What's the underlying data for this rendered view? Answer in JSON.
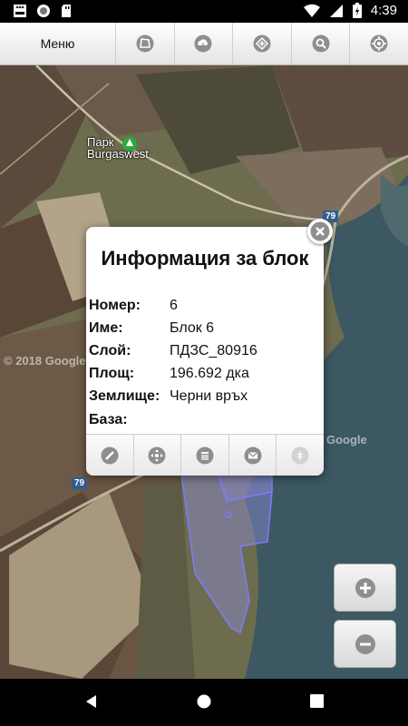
{
  "status_bar": {
    "time": "4:39",
    "icons": [
      "notification-app-icon",
      "circle-app-icon",
      "sd-card-icon",
      "wifi-icon",
      "signal-icon",
      "battery-icon"
    ]
  },
  "toolbar": {
    "menu_label": "Меню",
    "buttons": [
      "polygon-icon",
      "cloud-download-icon",
      "layers-icon",
      "search-icon",
      "gps-target-icon"
    ]
  },
  "map": {
    "poi_label_line1": "Парк",
    "poi_label_line2": "Burgaswest",
    "road_shield_top": "79",
    "road_shield_bottom": "79",
    "watermark_left": "© 2018 Google",
    "watermark_right": "Google"
  },
  "popup": {
    "title": "Информация за блок",
    "rows": [
      {
        "key": "Номер:",
        "value": "6"
      },
      {
        "key": "Име:",
        "value": "Блок 6"
      },
      {
        "key": "Слой:",
        "value": "ПДЗС_80916"
      },
      {
        "key": "Площ:",
        "value": "196.692 дка"
      },
      {
        "key": "Землище:",
        "value": "Черни връх"
      },
      {
        "key": "База:",
        "value": ""
      }
    ],
    "actions": [
      "edit-icon",
      "move-icon",
      "delete-icon",
      "mail-icon",
      "crop-icon"
    ]
  },
  "zoom": {
    "in": "plus-icon",
    "out": "minus-icon"
  },
  "colors": {
    "water": "#3d5a63",
    "field_dark": "#5b4a3b",
    "field_light": "#a89a80",
    "parcel_outline": "#7b7bff",
    "road_shield": "#2f5e8f"
  }
}
